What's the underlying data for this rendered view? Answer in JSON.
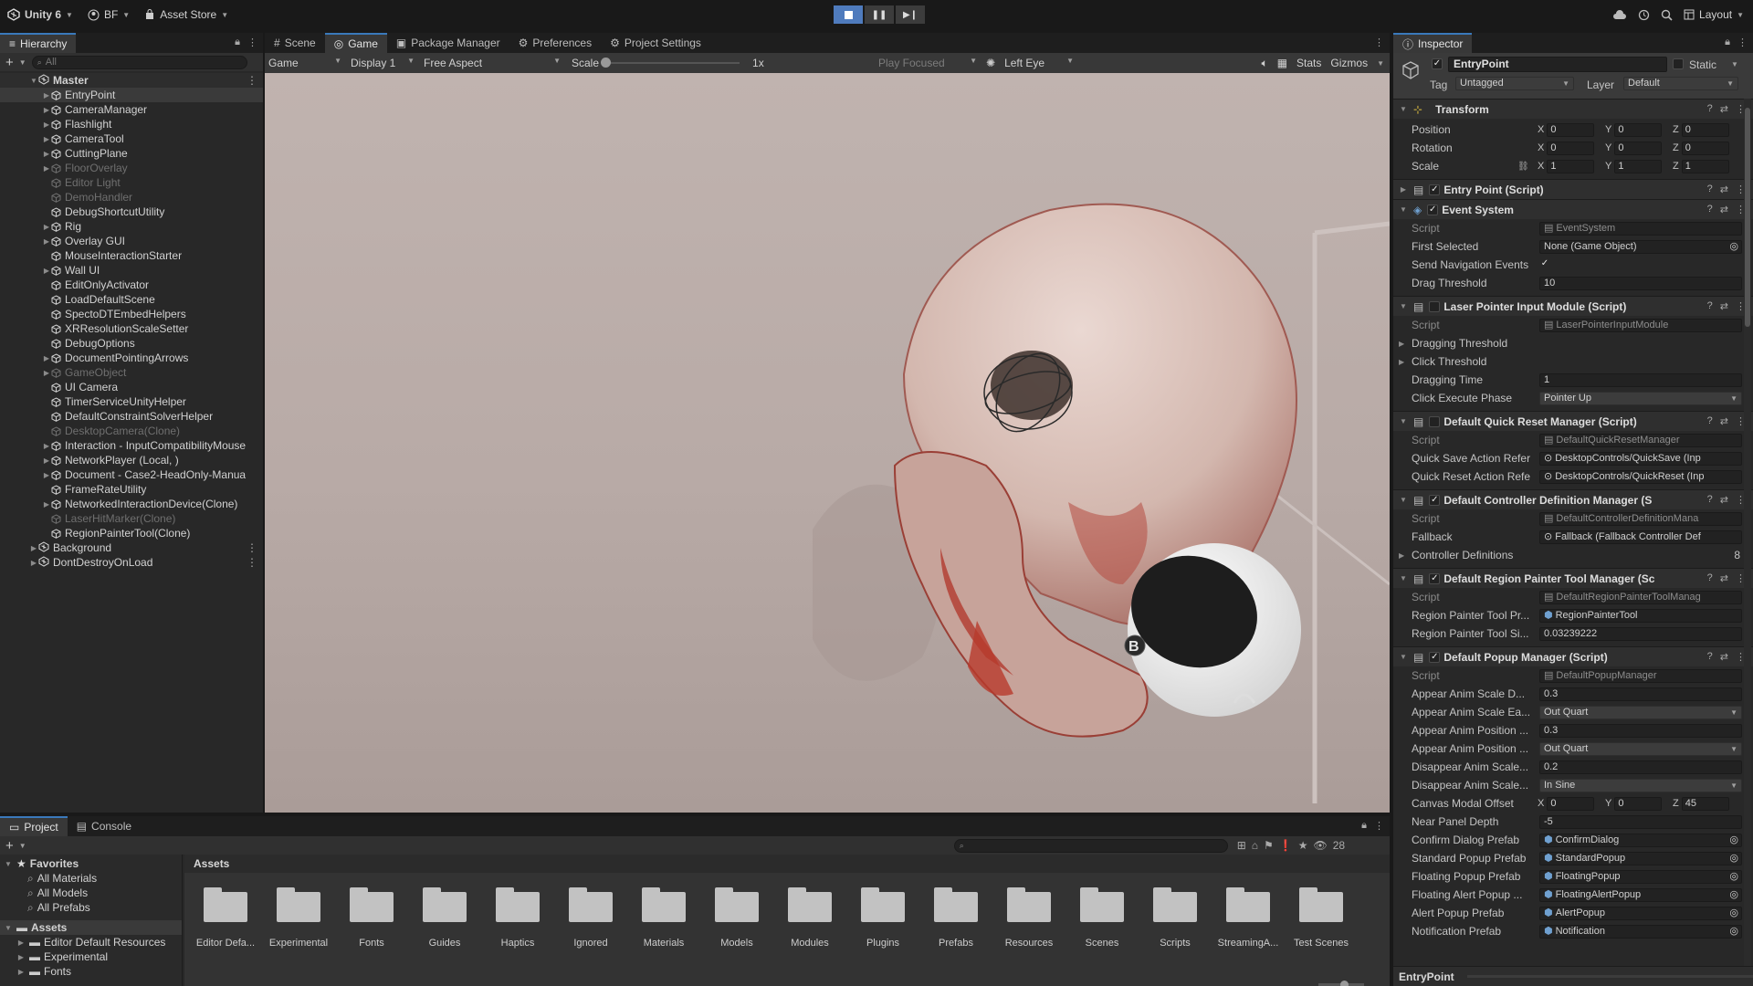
{
  "topbar": {
    "app_label": "Unity 6",
    "account_label": "BF",
    "asset_store_label": "Asset Store",
    "layout_label": "Layout"
  },
  "hierarchy": {
    "tab_label": "Hierarchy",
    "search_placeholder": "All",
    "scene_name": "Master",
    "items": [
      {
        "label": "EntryPoint",
        "dim": false,
        "sel": true,
        "arrow": true
      },
      {
        "label": "CameraManager",
        "dim": false,
        "arrow": true
      },
      {
        "label": "Flashlight",
        "dim": false,
        "arrow": true
      },
      {
        "label": "CameraTool",
        "dim": false,
        "arrow": true
      },
      {
        "label": "CuttingPlane",
        "dim": false,
        "arrow": true
      },
      {
        "label": "FloorOverlay",
        "dim": true,
        "arrow": true
      },
      {
        "label": "Editor Light",
        "dim": true,
        "arrow": false
      },
      {
        "label": "DemoHandler",
        "dim": true,
        "arrow": false
      },
      {
        "label": "DebugShortcutUtility",
        "dim": false,
        "arrow": false
      },
      {
        "label": "Rig",
        "dim": false,
        "arrow": true
      },
      {
        "label": "Overlay GUI",
        "dim": false,
        "arrow": true
      },
      {
        "label": "MouseInteractionStarter",
        "dim": false,
        "arrow": false
      },
      {
        "label": "Wall UI",
        "dim": false,
        "arrow": true
      },
      {
        "label": "EditOnlyActivator",
        "dim": false,
        "arrow": false
      },
      {
        "label": "LoadDefaultScene",
        "dim": false,
        "arrow": false
      },
      {
        "label": "SpectoDTEmbedHelpers",
        "dim": false,
        "arrow": false
      },
      {
        "label": "XRResolutionScaleSetter",
        "dim": false,
        "arrow": false
      },
      {
        "label": "DebugOptions",
        "dim": false,
        "arrow": false
      },
      {
        "label": "DocumentPointingArrows",
        "dim": false,
        "arrow": true
      },
      {
        "label": "GameObject",
        "dim": true,
        "arrow": true
      },
      {
        "label": "UI Camera",
        "dim": false,
        "arrow": false
      },
      {
        "label": "TimerServiceUnityHelper",
        "dim": false,
        "arrow": false
      },
      {
        "label": "DefaultConstraintSolverHelper",
        "dim": false,
        "arrow": false
      },
      {
        "label": "DesktopCamera(Clone)",
        "dim": true,
        "arrow": false
      },
      {
        "label": "Interaction - InputCompatibilityMouse",
        "dim": false,
        "arrow": true
      },
      {
        "label": "NetworkPlayer (Local, )",
        "dim": false,
        "arrow": true
      },
      {
        "label": "Document - Case2-HeadOnly-Manua",
        "dim": false,
        "arrow": true
      },
      {
        "label": "FrameRateUtility",
        "dim": false,
        "arrow": false
      },
      {
        "label": "NetworkedInteractionDevice(Clone)",
        "dim": false,
        "arrow": true
      },
      {
        "label": "LaserHitMarker(Clone)",
        "dim": true,
        "arrow": false
      },
      {
        "label": "RegionPainterTool(Clone)",
        "dim": false,
        "arrow": false
      }
    ],
    "roots": [
      "Background",
      "DontDestroyOnLoad"
    ]
  },
  "center_tabs": [
    "Scene",
    "Game",
    "Package Manager",
    "Preferences",
    "Project Settings"
  ],
  "game_toolbar": {
    "view": "Game",
    "display": "Display 1",
    "aspect": "Free Aspect",
    "scale_label": "Scale",
    "scale_value": "1x",
    "play_mode": "Play Focused",
    "eye": "Left Eye",
    "stats": "Stats",
    "gizmos": "Gizmos"
  },
  "viewport": {
    "controller_button": "B"
  },
  "inspector": {
    "tab_label": "Inspector",
    "object_name": "EntryPoint",
    "static_label": "Static",
    "tag_label": "Tag",
    "tag_value": "Untagged",
    "layer_label": "Layer",
    "layer_value": "Default",
    "transform": {
      "title": "Transform",
      "position_label": "Position",
      "rotation_label": "Rotation",
      "scale_label": "Scale",
      "position": [
        "0",
        "0",
        "0"
      ],
      "rotation": [
        "0",
        "0",
        "0"
      ],
      "scale": [
        "1",
        "1",
        "1"
      ]
    },
    "entry_point_title": "Entry Point (Script)",
    "event_system": {
      "title": "Event System",
      "script_label": "Script",
      "script_value": "EventSystem",
      "first_selected_label": "First Selected",
      "first_selected_value": "None (Game Object)",
      "send_nav_label": "Send Navigation Events",
      "drag_threshold_label": "Drag Threshold",
      "drag_threshold_value": "10"
    },
    "laser": {
      "title": "Laser Pointer Input Module (Script)",
      "script_label": "Script",
      "script_value": "LaserPointerInputModule",
      "dragging_threshold_label": "Dragging Threshold",
      "click_threshold_label": "Click Threshold",
      "dragging_time_label": "Dragging Time",
      "dragging_time_value": "1",
      "click_phase_label": "Click Execute Phase",
      "click_phase_value": "Pointer Up"
    },
    "quick_reset": {
      "title": "Default Quick Reset Manager (Script)",
      "script_label": "Script",
      "script_value": "DefaultQuickResetManager",
      "save_label": "Quick Save Action Refer",
      "save_value": "DesktopControls/QuickSave (Inp",
      "reset_label": "Quick Reset Action Refe",
      "reset_value": "DesktopControls/QuickReset (Inp"
    },
    "controller_def": {
      "title": "Default Controller Definition Manager (S",
      "script_label": "Script",
      "script_value": "DefaultControllerDefinitionMana",
      "fallback_label": "Fallback",
      "fallback_value": "Fallback (Fallback Controller Def",
      "defs_label": "Controller Definitions",
      "defs_count": "8"
    },
    "region_painter": {
      "title": "Default Region Painter Tool Manager (Sc",
      "script_label": "Script",
      "script_value": "DefaultRegionPainterToolManag",
      "prefab_label": "Region Painter Tool Pr...",
      "prefab_value": "RegionPainterTool",
      "size_label": "Region Painter Tool Si...",
      "size_value": "0.03239222"
    },
    "popup": {
      "title": "Default Popup Manager (Script)",
      "script_label": "Script",
      "script_value": "DefaultPopupManager",
      "rows": [
        {
          "label": "Appear Anim Scale D...",
          "value": "0.3",
          "kind": "field"
        },
        {
          "label": "Appear Anim Scale Ea...",
          "value": "Out Quart",
          "kind": "drop"
        },
        {
          "label": "Appear Anim Position ...",
          "value": "0.3",
          "kind": "field"
        },
        {
          "label": "Appear Anim Position ...",
          "value": "Out Quart",
          "kind": "drop"
        },
        {
          "label": "Disappear Anim Scale...",
          "value": "0.2",
          "kind": "field"
        },
        {
          "label": "Disappear Anim Scale...",
          "value": "In Sine",
          "kind": "drop"
        }
      ],
      "canvas_offset_label": "Canvas Modal Offset",
      "canvas_offset": [
        "0",
        "0",
        "45"
      ],
      "near_panel_label": "Near Panel Depth",
      "near_panel_value": "-5",
      "prefabs": [
        {
          "label": "Confirm Dialog Prefab",
          "value": "ConfirmDialog"
        },
        {
          "label": "Standard Popup Prefab",
          "value": "StandardPopup"
        },
        {
          "label": "Floating Popup Prefab",
          "value": "FloatingPopup"
        },
        {
          "label": "Floating Alert Popup ...",
          "value": "FloatingAlertPopup"
        },
        {
          "label": "Alert Popup Prefab",
          "value": "AlertPopup"
        },
        {
          "label": "Notification Prefab",
          "value": "Notification"
        }
      ]
    },
    "footer_label": "EntryPoint"
  },
  "project": {
    "tabs": [
      "Project",
      "Console"
    ],
    "favorites_label": "Favorites",
    "favorites": [
      "All Materials",
      "All Models",
      "All Prefabs"
    ],
    "assets_label": "Assets",
    "asset_tree": [
      "Editor Default Resources",
      "Experimental",
      "Fonts"
    ],
    "breadcrumb": "Assets",
    "hidden_count": "28",
    "folders": [
      "Editor Defa...",
      "Experimental",
      "Fonts",
      "Guides",
      "Haptics",
      "Ignored",
      "Materials",
      "Models",
      "Modules",
      "Plugins",
      "Prefabs",
      "Resources",
      "Scenes",
      "Scripts",
      "StreamingA...",
      "Test Scenes"
    ]
  }
}
